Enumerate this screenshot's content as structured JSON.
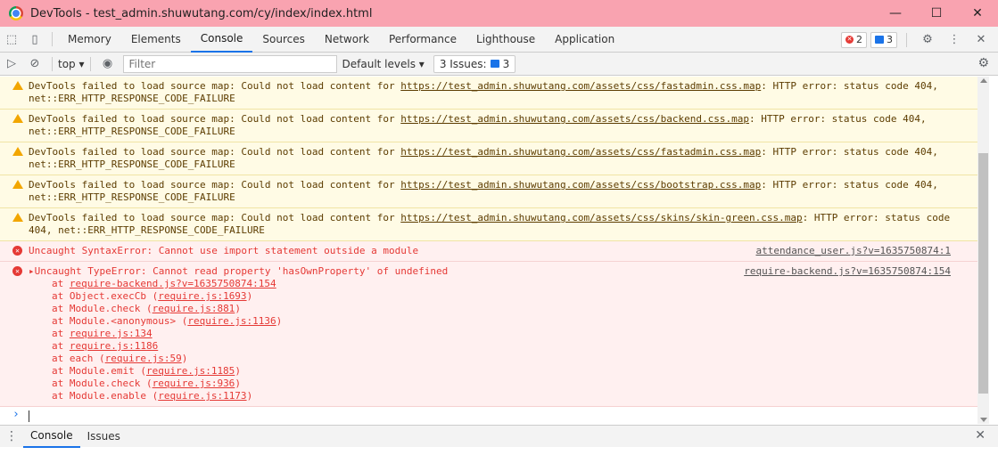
{
  "window": {
    "title": "DevTools - test_admin.shuwutang.com/cy/index/index.html",
    "controls": [
      "—",
      "☐",
      "✕"
    ]
  },
  "tabs": {
    "items": [
      "Memory",
      "Elements",
      "Console",
      "Sources",
      "Network",
      "Performance",
      "Lighthouse",
      "Application"
    ],
    "active": "Console",
    "error_count": "2",
    "message_count": "3"
  },
  "toolbar": {
    "context": "top",
    "filter_placeholder": "Filter",
    "levels": "Default levels",
    "issues_label": "3 Issues:",
    "issues_count": "3"
  },
  "messages": [
    {
      "type": "warning",
      "prefix": "DevTools failed to load source map: Could not load content for ",
      "url": "https://test_admin.shuwutang.com/assets/css/fastadmin.css.map",
      "suffix": ": HTTP error: status code 404,",
      "line2": "net::ERR_HTTP_RESPONSE_CODE_FAILURE"
    },
    {
      "type": "warning",
      "prefix": "DevTools failed to load source map: Could not load content for ",
      "url": "https://test_admin.shuwutang.com/assets/css/backend.css.map",
      "suffix": ": HTTP error: status code 404,",
      "line2": "net::ERR_HTTP_RESPONSE_CODE_FAILURE"
    },
    {
      "type": "warning",
      "prefix": "DevTools failed to load source map: Could not load content for ",
      "url": "https://test_admin.shuwutang.com/assets/css/fastadmin.css.map",
      "suffix": ": HTTP error: status code 404,",
      "line2": "net::ERR_HTTP_RESPONSE_CODE_FAILURE"
    },
    {
      "type": "warning",
      "prefix": "DevTools failed to load source map: Could not load content for ",
      "url": "https://test_admin.shuwutang.com/assets/css/bootstrap.css.map",
      "suffix": ": HTTP error: status code 404,",
      "line2": "net::ERR_HTTP_RESPONSE_CODE_FAILURE"
    },
    {
      "type": "warning",
      "prefix": "DevTools failed to load source map: Could not load content for ",
      "url": "https://test_admin.shuwutang.com/assets/css/skins/skin-green.css.map",
      "suffix": ": HTTP error: status code",
      "line2": "404, net::ERR_HTTP_RESPONSE_CODE_FAILURE"
    }
  ],
  "error1": {
    "text": "Uncaught SyntaxError: Cannot use import statement outside a module",
    "source": "attendance_user.js?v=1635750874:1"
  },
  "error2": {
    "text": "Uncaught TypeError: Cannot read property 'hasOwnProperty' of undefined",
    "source": "require-backend.js?v=1635750874:154",
    "stack": [
      {
        "prefix": "at ",
        "link": "require-backend.js?v=1635750874:154",
        "suffix": ""
      },
      {
        "prefix": "at Object.execCb (",
        "link": "require.js:1693",
        "suffix": ")"
      },
      {
        "prefix": "at Module.check (",
        "link": "require.js:881",
        "suffix": ")"
      },
      {
        "prefix": "at Module.<anonymous> (",
        "link": "require.js:1136",
        "suffix": ")"
      },
      {
        "prefix": "at ",
        "link": "require.js:134",
        "suffix": ""
      },
      {
        "prefix": "at ",
        "link": "require.js:1186",
        "suffix": ""
      },
      {
        "prefix": "at each (",
        "link": "require.js:59",
        "suffix": ")"
      },
      {
        "prefix": "at Module.emit (",
        "link": "require.js:1185",
        "suffix": ")"
      },
      {
        "prefix": "at Module.check (",
        "link": "require.js:936",
        "suffix": ")"
      },
      {
        "prefix": "at Module.enable (",
        "link": "require.js:1173",
        "suffix": ")"
      }
    ]
  },
  "drawer": {
    "tabs": [
      "Console",
      "Issues"
    ]
  }
}
